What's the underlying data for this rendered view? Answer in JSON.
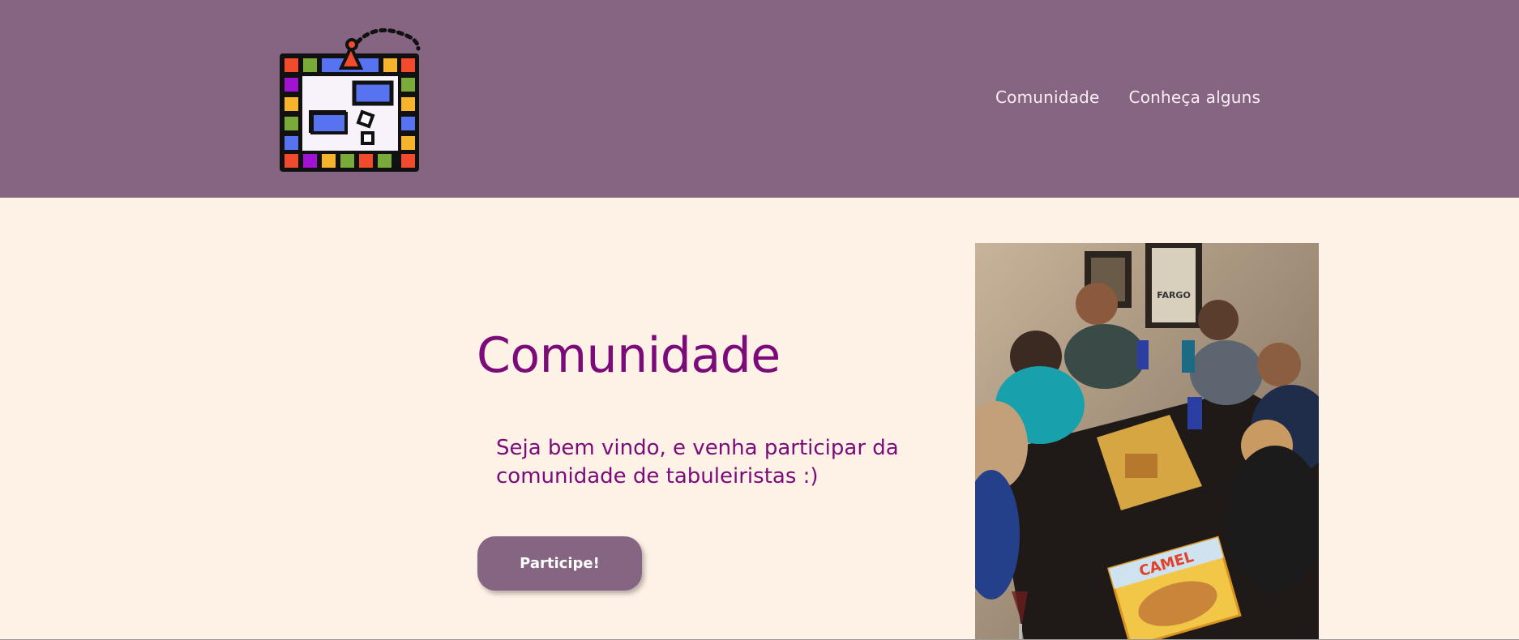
{
  "colors": {
    "header_bg": "#856582",
    "page_bg": "#fef1e6",
    "accent_text": "#7b0b79",
    "nav_text": "#fbeff3",
    "button_bg": "#856582"
  },
  "header": {
    "logo_icon": "board-game-icon",
    "nav": [
      {
        "label": "Comunidade"
      },
      {
        "label": "Conheça alguns"
      }
    ]
  },
  "main": {
    "title": "Comunidade",
    "description": "Seja bem vindo, e venha participar da comunidade de tabuleiristas :)",
    "cta_label": "Participe!",
    "photo_icon": "people-playing-board-game-photo"
  }
}
